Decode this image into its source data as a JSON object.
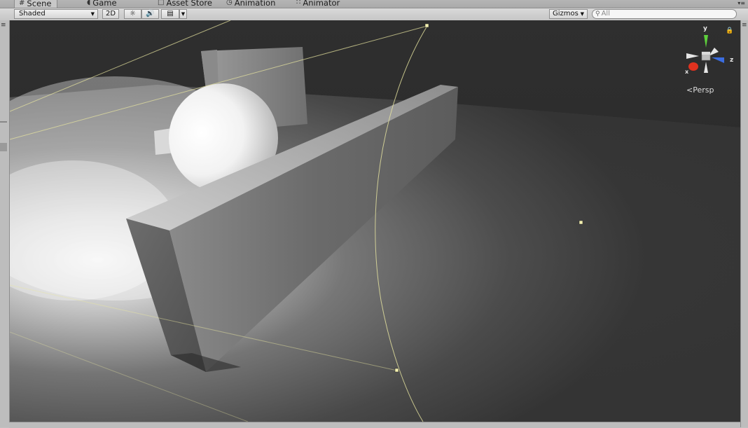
{
  "tabs": [
    {
      "label": "Scene",
      "icon": "grid-icon",
      "active": true
    },
    {
      "label": "Game",
      "icon": "pacman-icon",
      "active": false
    },
    {
      "label": "Asset Store",
      "icon": "bag-icon",
      "active": false
    },
    {
      "label": "Animation",
      "icon": "clock-icon",
      "active": false
    },
    {
      "label": "Animator",
      "icon": "animator-icon",
      "active": false
    }
  ],
  "toolbar": {
    "shading_mode": "Shaded",
    "toggle_2d": "2D",
    "gizmos_label": "Gizmos",
    "search_placeholder": "All"
  },
  "scene_gizmo": {
    "axis_y": "y",
    "axis_z": "z",
    "axis_x": "x",
    "projection": "Persp"
  },
  "colors": {
    "axis_y": "#5ed03c",
    "axis_z": "#3b6de0",
    "axis_x": "#e0321f",
    "gizmo_wire": "#e8e6a0"
  }
}
